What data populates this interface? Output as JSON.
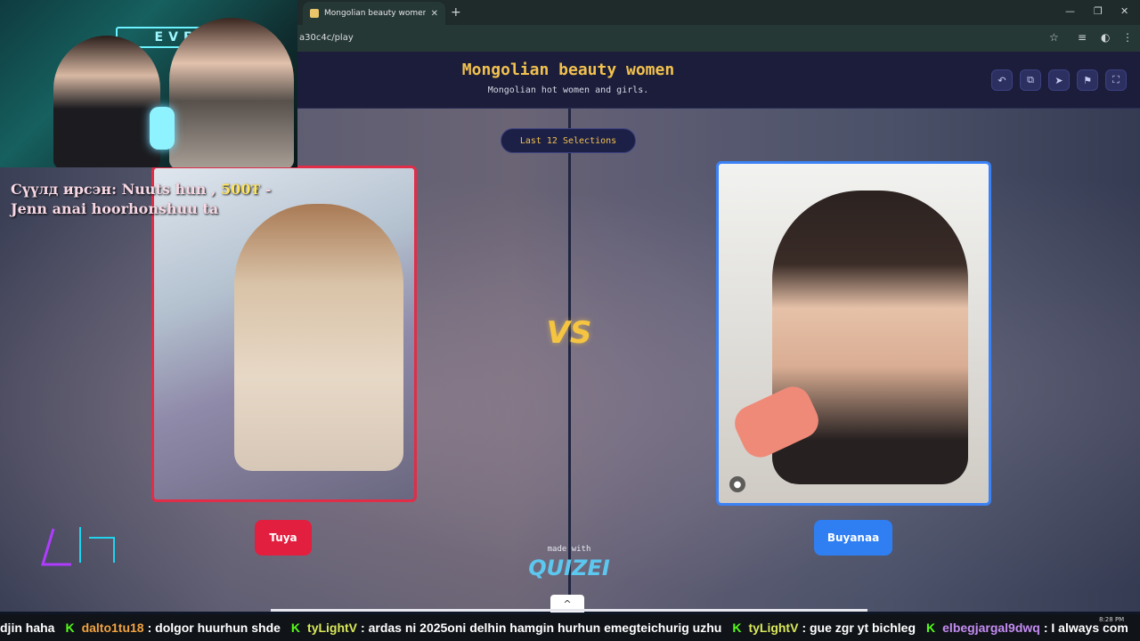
{
  "browser": {
    "tab_title": "Mongolian beauty women - Ti",
    "new_tab": "+",
    "url": "a30c4c/play",
    "window_controls": {
      "minimize": "—",
      "restore": "❐",
      "close": "✕"
    }
  },
  "header": {
    "title": "Mongolian beauty women",
    "subtitle": "Mongolian hot women and girls.",
    "icons": [
      "undo-icon",
      "share-icon",
      "send-icon",
      "flag-icon",
      "fullscreen-icon"
    ]
  },
  "stage": {
    "selections_pill": "Last 12 Selections",
    "vs_label": "VS",
    "left": {
      "name": "Tuya",
      "color": "#e21f3f"
    },
    "right": {
      "name": "Buyanaa",
      "color": "#2f7ff2"
    },
    "made_with": "made with",
    "brand": "QUIZEI",
    "scroll_up": "^"
  },
  "overlay": {
    "cam_sign": "EVEL",
    "donation_prefix": "Сүүлд ирсэн: Nuuts hun ,",
    "donation_amount": "500₮",
    "donation_suffix": "-",
    "donation_line2": "Jenn anai hoorhonshuu ta"
  },
  "ticker": [
    {
      "user": "",
      "message": "djin haha",
      "color": "#ffffff"
    },
    {
      "user": "dalto1tu18",
      "message": ": dolgor huurhun shde",
      "color": "#f2a341"
    },
    {
      "user": "tyLightV",
      "message": ": ardas ni 2025oni delhin hamgin hurhun emegteichurig uzhu",
      "color": "#d9e85a"
    },
    {
      "user": "tyLightV",
      "message": ": gue zgr yt bichleg",
      "color": "#d9e85a"
    },
    {
      "user": "elbegjargal9dwq",
      "message": ": I always com",
      "color": "#c48cf2"
    }
  ],
  "clock": "8:28 PM"
}
